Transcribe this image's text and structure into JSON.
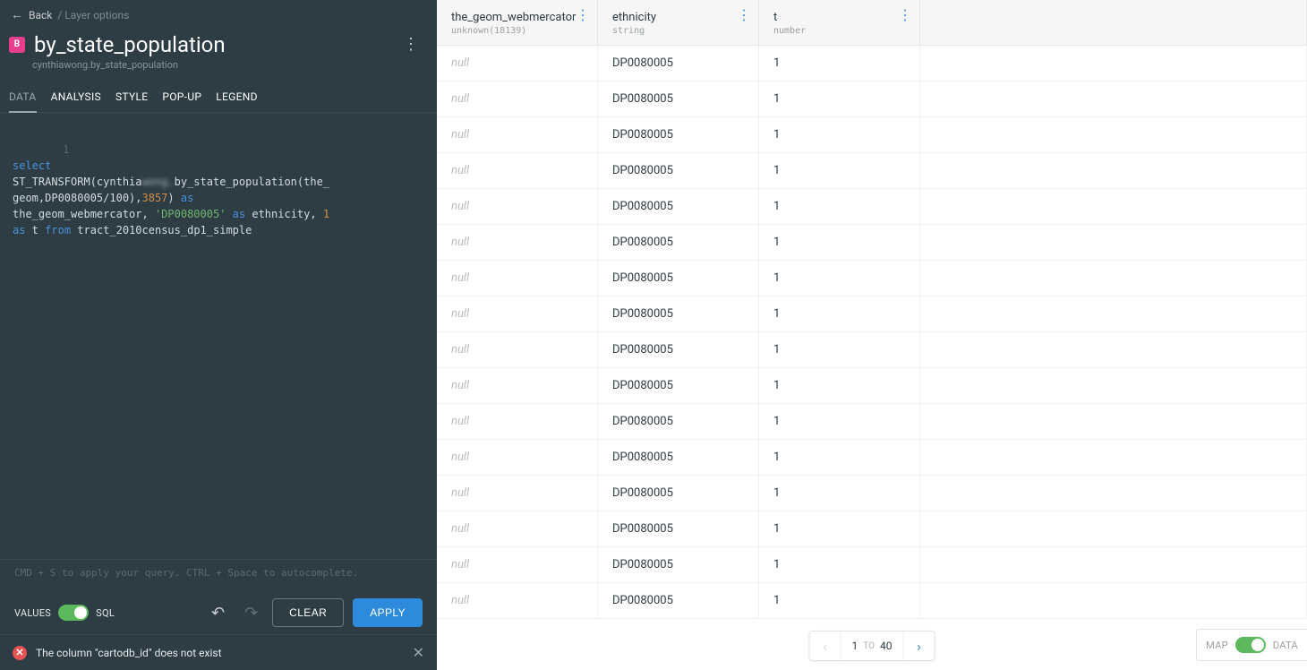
{
  "header": {
    "back_label": "Back",
    "breadcrumb_tail": "/ Layer options",
    "layer_badge": "B",
    "title": "by_state_population",
    "subtitle": "cynthiawong.by_state_population"
  },
  "tabs": [
    "DATA",
    "ANALYSIS",
    "STYLE",
    "POP-UP",
    "LEGEND"
  ],
  "active_tab": "DATA",
  "sql": {
    "line_number": "1",
    "tokens": [
      {
        "t": "kw",
        "v": "select"
      },
      {
        "t": "br"
      },
      {
        "t": "pl",
        "v": "ST_TRANSFORM(cynthia"
      },
      {
        "t": "blur",
        "v": "wong."
      },
      {
        "t": "pl",
        "v": "by_state_population(the_"
      },
      {
        "t": "br"
      },
      {
        "t": "pl",
        "v": "geom,DP0080005/100),"
      },
      {
        "t": "num",
        "v": "3857"
      },
      {
        "t": "pl",
        "v": ") "
      },
      {
        "t": "kw",
        "v": "as"
      },
      {
        "t": "br"
      },
      {
        "t": "pl",
        "v": "the_geom_webmercator, "
      },
      {
        "t": "str",
        "v": "'DP0080005'"
      },
      {
        "t": "pl",
        "v": " "
      },
      {
        "t": "kw",
        "v": "as"
      },
      {
        "t": "pl",
        "v": " ethnicity, "
      },
      {
        "t": "num",
        "v": "1"
      },
      {
        "t": "br"
      },
      {
        "t": "kw",
        "v": "as"
      },
      {
        "t": "pl",
        "v": " t "
      },
      {
        "t": "kw",
        "v": "from"
      },
      {
        "t": "pl",
        "v": " tract_2010census_dp1_simple"
      }
    ]
  },
  "hint": "CMD + S to apply your query. CTRL + Space to autocomplete.",
  "values_toggle": {
    "left_label": "VALUES",
    "right_label": "SQL",
    "on": true
  },
  "buttons": {
    "clear": "CLEAR",
    "apply": "APPLY"
  },
  "error": {
    "message": "The column \"cartodb_id\" does not exist"
  },
  "columns": [
    {
      "name": "the_geom_webmercator",
      "type": "unknown(18139)"
    },
    {
      "name": "ethnicity",
      "type": "string"
    },
    {
      "name": "t",
      "type": "number"
    }
  ],
  "rows": [
    {
      "c1": "null",
      "c2": "DP0080005",
      "c3": "1"
    },
    {
      "c1": "null",
      "c2": "DP0080005",
      "c3": "1"
    },
    {
      "c1": "null",
      "c2": "DP0080005",
      "c3": "1"
    },
    {
      "c1": "null",
      "c2": "DP0080005",
      "c3": "1"
    },
    {
      "c1": "null",
      "c2": "DP0080005",
      "c3": "1"
    },
    {
      "c1": "null",
      "c2": "DP0080005",
      "c3": "1"
    },
    {
      "c1": "null",
      "c2": "DP0080005",
      "c3": "1"
    },
    {
      "c1": "null",
      "c2": "DP0080005",
      "c3": "1"
    },
    {
      "c1": "null",
      "c2": "DP0080005",
      "c3": "1"
    },
    {
      "c1": "null",
      "c2": "DP0080005",
      "c3": "1"
    },
    {
      "c1": "null",
      "c2": "DP0080005",
      "c3": "1"
    },
    {
      "c1": "null",
      "c2": "DP0080005",
      "c3": "1"
    },
    {
      "c1": "null",
      "c2": "DP0080005",
      "c3": "1"
    },
    {
      "c1": "null",
      "c2": "DP0080005",
      "c3": "1"
    },
    {
      "c1": "null",
      "c2": "DP0080005",
      "c3": "1"
    },
    {
      "c1": "null",
      "c2": "DP0080005",
      "c3": "1"
    }
  ],
  "pager": {
    "from": "1",
    "to_label": "TO",
    "to": "40"
  },
  "view_toggle": {
    "left": "MAP",
    "right": "DATA"
  }
}
